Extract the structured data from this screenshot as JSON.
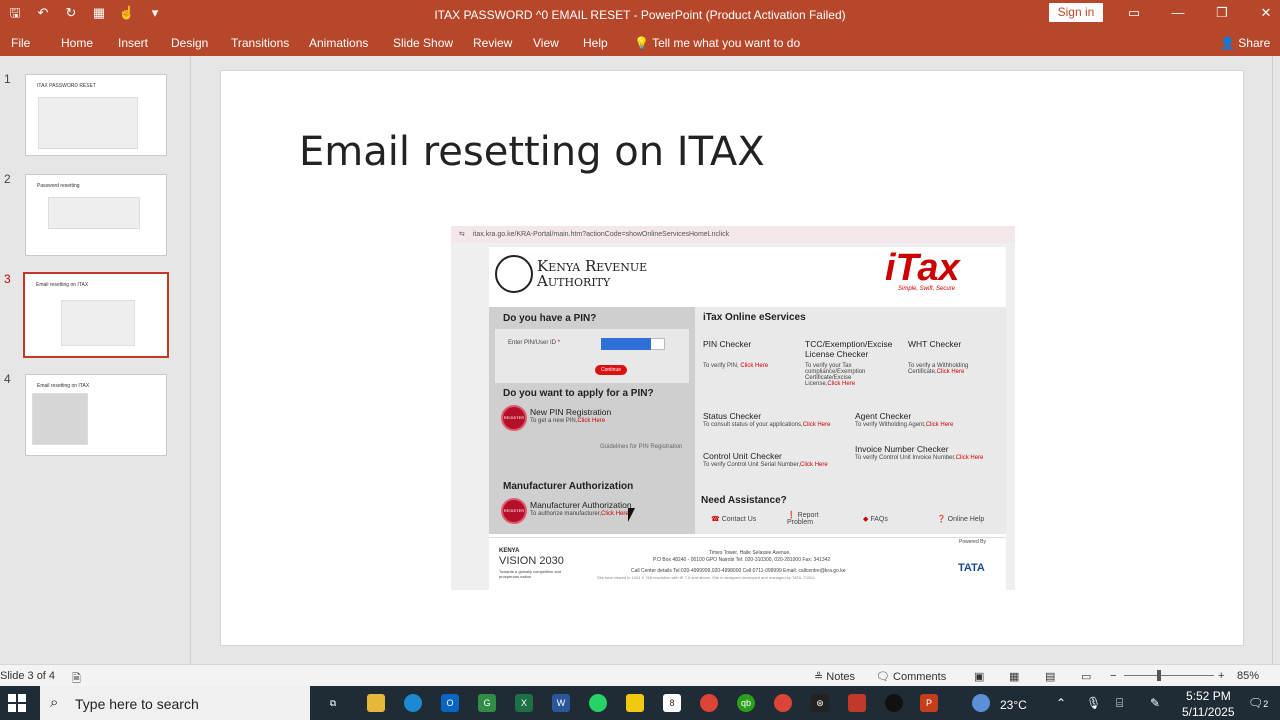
{
  "window": {
    "title": "ITAX PASSWORD ^0 EMAIL RESET  -  PowerPoint (Product Activation Failed)",
    "sign_in": "Sign in"
  },
  "ribbon": {
    "tabs": [
      "File",
      "Home",
      "Insert",
      "Design",
      "Transitions",
      "Animations",
      "Slide Show",
      "Review",
      "View",
      "Help"
    ],
    "tell_me": "Tell me what you want to do",
    "share": "Share"
  },
  "thumbnails": [
    {
      "num": "1",
      "title": "ITAX PASSWORD RESET"
    },
    {
      "num": "2",
      "title": "Password resetting"
    },
    {
      "num": "3",
      "title": "Email resetting on ITAX"
    },
    {
      "num": "4",
      "title": "Email resetting on ITAX"
    }
  ],
  "slide": {
    "title": "Email resetting on ITAX",
    "screenshot": {
      "url": "itax.kra.go.ke/KRA-Portal/main.htm?actionCode=showOnlineServicesHomeLnclick",
      "kra_name_1": "Kenya Revenue",
      "kra_name_2": "Authority",
      "itax_logo": "iTax",
      "itax_slogan": "Simple, Swift, Secure",
      "left": {
        "have_pin": "Do you have a PIN?",
        "enter_pin": "Enter PIN/User ID",
        "required_mark": "*",
        "continue": "Continue",
        "apply_pin": "Do you want to apply for a PIN?",
        "new_pin_reg": "New PIN Registration",
        "new_pin_desc": "To get a new PIN,",
        "click_here": "Click Here",
        "guidelines": "Guidelines for PIN Registration",
        "manu_heading": "Manufacturer Authorization",
        "manu_item": "Manufacturer Authorization",
        "manu_desc": "To authorize manufacturer,",
        "manu_click": "Click Here",
        "register": "REGISTER"
      },
      "right": {
        "heading": "iTax Online eServices",
        "pin_checker": "PIN Checker",
        "pin_checker_desc": "To verify PIN,",
        "tcc": "TCC/Exemption/Excise License Checker",
        "tcc_desc": "To verify your Tax compliance/Exemption Certificate/Excise License,",
        "wht": "WHT Checker",
        "wht_desc": "To verify a Withholding Certificate,",
        "status": "Status Checker",
        "status_desc": "To consult status of your applications,",
        "agent": "Agent Checker",
        "agent_desc": "To verify Witholding Agent,",
        "cu": "Control Unit Checker",
        "cu_desc": "To verify Control Unit Serial Number,",
        "inv": "Invoice Number Checker",
        "inv_desc": "To verify Control Unit Invoice Number,",
        "click_here": "Click Here",
        "assist": "Need Assistance?",
        "contact": "Contact Us",
        "report": "Report Problem",
        "faq": "FAQs",
        "help": "Online Help"
      },
      "footer": {
        "vision_1": "KENYA",
        "vision_2": "VISION 2030",
        "vision_3": "Towards a globally competitive and prosperous nation",
        "addr1": "Times Tower, Haile Selassie Avenue,",
        "addr2": "P.O Box 48240 - 00100 GPO Nairobi Tel: 020-310300, 020-281000 Fax: 341342",
        "addr3": "Call Center details Tel:020-4999999,020-4998000 Cell:0711-099999 Email: callcentre@kra.go.ke",
        "addr4": "Site best viewed in 1024 X 768 resolution with IE 7.0 and above. Site is designed developed and managed by TATA. ©2011",
        "powered": "Powered By",
        "tata": "TATA"
      }
    }
  },
  "status_bar": {
    "slide_count": "Slide 3 of 4",
    "notes": "Notes",
    "comments": "Comments",
    "zoom": "85%"
  },
  "taskbar": {
    "search_placeholder": "Type here to search",
    "temperature": "23°C",
    "time": "5:52 PM",
    "date": "5/11/2025",
    "notif_count": "2"
  }
}
